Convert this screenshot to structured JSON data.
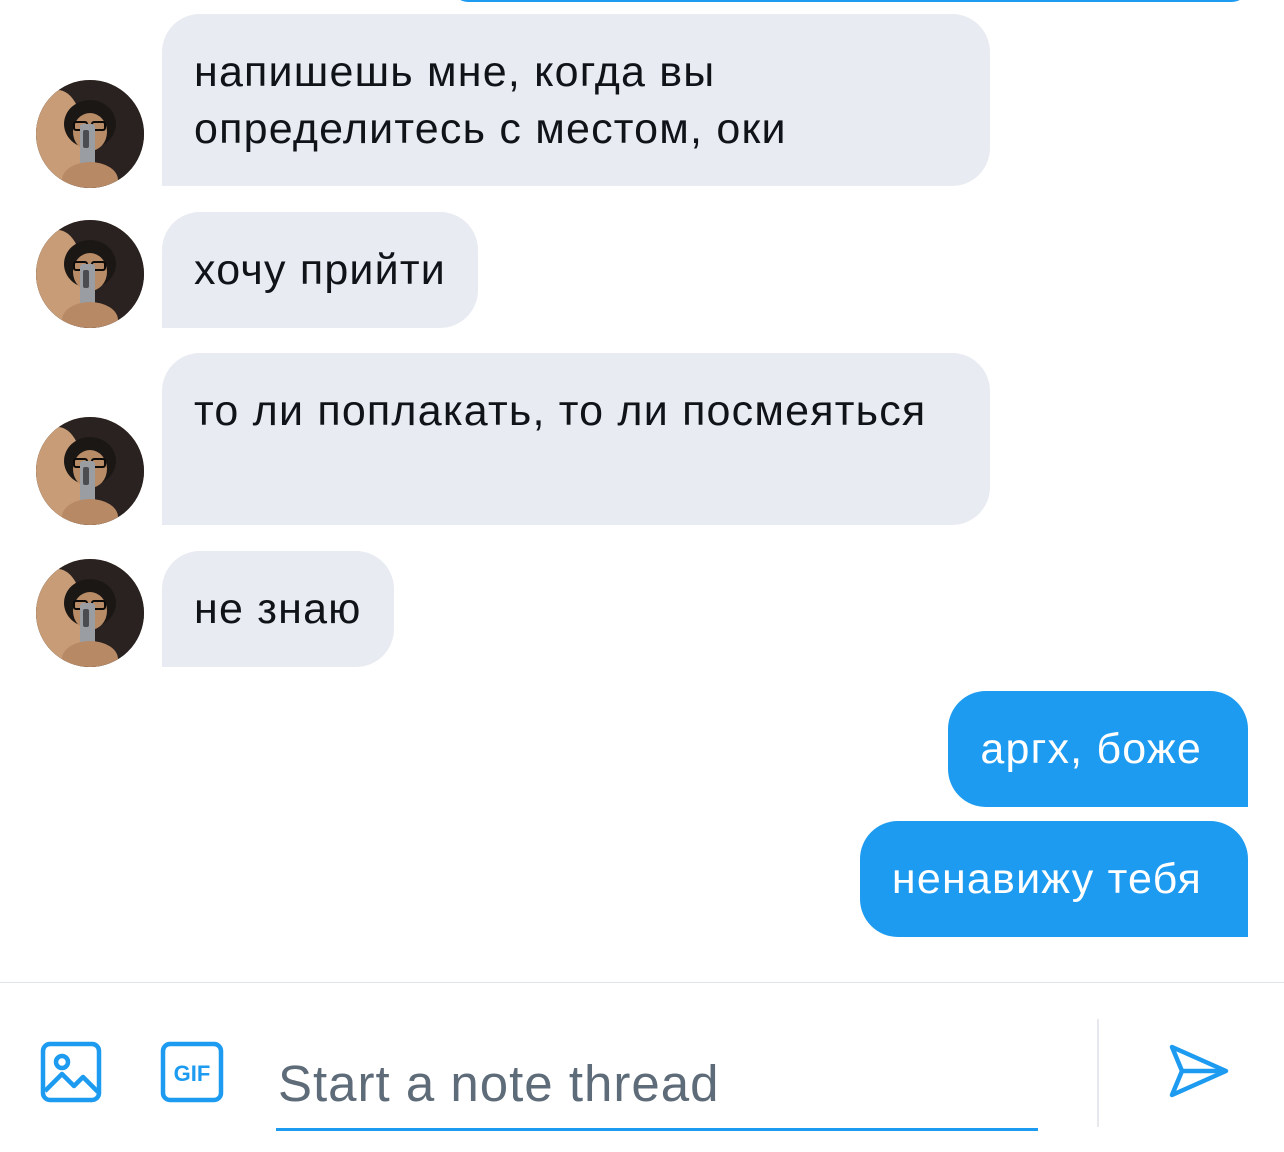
{
  "messages": [
    {
      "direction": "incoming",
      "text": "напишешь мне, когда вы определитесь с местом, оки"
    },
    {
      "direction": "incoming",
      "text": "хочу прийти"
    },
    {
      "direction": "incoming",
      "text": "то ли поплакать, то ли посмеяться"
    },
    {
      "direction": "incoming",
      "text": "не знаю"
    },
    {
      "direction": "outgoing",
      "text": "аргх, боже"
    },
    {
      "direction": "outgoing",
      "text": "ненавижу тебя"
    }
  ],
  "composer": {
    "placeholder": "Start a note thread",
    "gif_label": "GIF",
    "media_icon": "image-icon",
    "send_icon": "send-icon"
  },
  "colors": {
    "accent": "#1d9bf0",
    "incoming_bubble": "#e9ebf2",
    "incoming_text": "#101418",
    "outgoing_text": "#ffffff",
    "placeholder": "#5e6b78"
  }
}
